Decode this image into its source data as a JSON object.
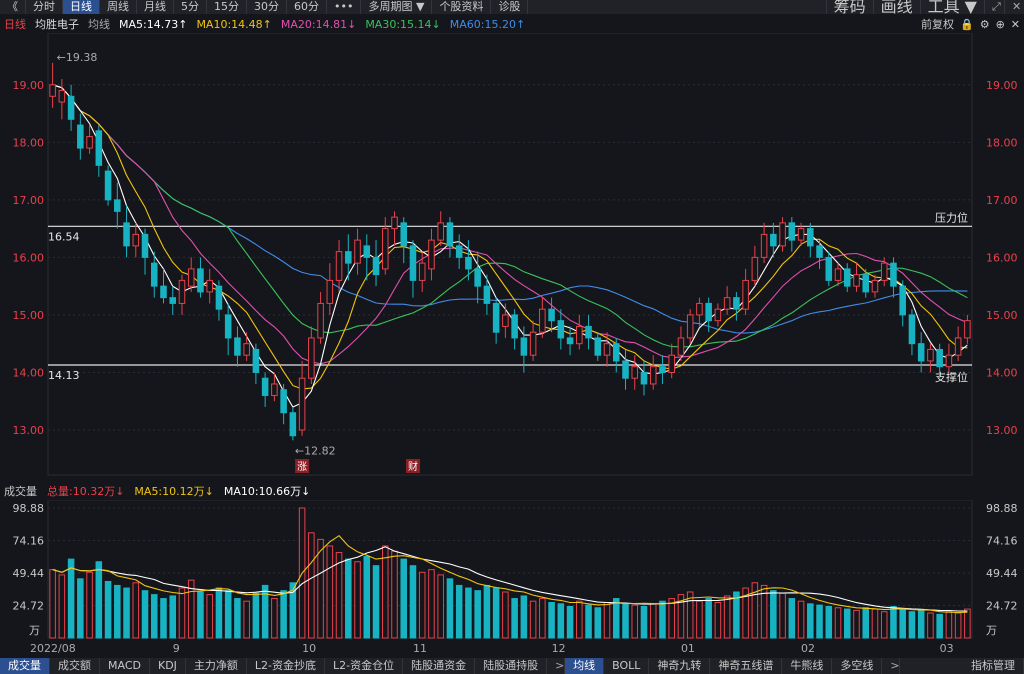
{
  "toolbar": {
    "back": "《",
    "items": [
      "分时",
      "日线",
      "周线",
      "月线",
      "5分",
      "15分",
      "30分",
      "60分",
      "•••",
      "多周期图 ▼",
      "个股资料",
      "诊股"
    ],
    "active_index": 1,
    "right": [
      "筹码",
      "画线",
      "工具 ▼"
    ],
    "icons": [
      "⤢",
      "✕"
    ]
  },
  "ma_bar": {
    "period": "日线",
    "stock": "均胜电子",
    "label": "均线",
    "ma5": "MA5:14.73↑",
    "ma10": "MA10:14.48↑",
    "ma20": "MA20:14.81↓",
    "ma30": "MA30:15.14↓",
    "ma60": "MA60:15.20↑",
    "adjust": "前复权"
  },
  "price_axis": {
    "labels": [
      "19.00",
      "18.00",
      "17.00",
      "16.00",
      "15.00",
      "14.00",
      "13.00"
    ],
    "values": [
      19,
      18,
      17,
      16,
      15,
      14,
      13
    ]
  },
  "annotations": {
    "high": "←19.38",
    "low": "←12.82",
    "resistance_value": "16.54",
    "resistance_label": "压力位",
    "support_value": "14.13",
    "support_label": "支撑位",
    "badge1": "涨",
    "badge2": "财"
  },
  "colors": {
    "up": "#e8414b",
    "down": "#18b3c2",
    "ma5": "#ffffff",
    "ma10": "#f1c40f",
    "ma20": "#e050b0",
    "ma30": "#3ac25a",
    "ma60": "#3f8ce8"
  },
  "volume": {
    "title": "成交量",
    "total": "总量:10.32万↓",
    "ma5": "MA5:10.12万↓",
    "ma10": "MA10:10.66万↓",
    "axis_labels": [
      "98.88",
      "74.16",
      "49.44",
      "24.72",
      "万"
    ],
    "axis_values": [
      98.88,
      74.16,
      49.44,
      24.72
    ]
  },
  "xaxis": [
    "2022/08",
    "9",
    "10",
    "11",
    "12",
    "01",
    "02",
    "03"
  ],
  "tabs": [
    "成交量",
    "成交额",
    "MACD",
    "KDJ",
    "主力净额",
    "L2-资金抄底",
    "L2-资金仓位",
    "陆股通资金",
    "陆股通持股",
    ">",
    "均线",
    "BOLL",
    "神奇九转",
    "神奇五线谱",
    "牛熊线",
    "多空线",
    ">",
    "指标管理"
  ],
  "active_tab": 0,
  "active_tab2": 10,
  "chart_data": {
    "type": "candlestick",
    "ylim": [
      12.6,
      19.9
    ],
    "candles": [
      [
        18.8,
        19.0,
        19.38,
        18.6
      ],
      [
        18.7,
        18.9,
        19.1,
        18.4
      ],
      [
        18.8,
        18.4,
        19.0,
        18.2
      ],
      [
        18.3,
        17.9,
        18.5,
        17.7
      ],
      [
        17.9,
        18.1,
        18.3,
        17.8
      ],
      [
        18.2,
        17.6,
        18.3,
        17.4
      ],
      [
        17.5,
        17.0,
        17.6,
        16.9
      ],
      [
        17.0,
        16.8,
        17.3,
        16.5
      ],
      [
        16.6,
        16.2,
        16.9,
        16.0
      ],
      [
        16.2,
        16.4,
        16.6,
        16.0
      ],
      [
        16.4,
        16.0,
        16.5,
        15.7
      ],
      [
        15.9,
        15.5,
        16.1,
        15.3
      ],
      [
        15.5,
        15.3,
        15.8,
        15.2
      ],
      [
        15.3,
        15.2,
        15.5,
        15.0
      ],
      [
        15.2,
        15.6,
        15.7,
        15.0
      ],
      [
        15.5,
        15.8,
        16.0,
        15.4
      ],
      [
        15.8,
        15.4,
        16.0,
        15.3
      ],
      [
        15.4,
        15.6,
        15.8,
        15.2
      ],
      [
        15.5,
        15.1,
        15.6,
        14.9
      ],
      [
        15.0,
        14.6,
        15.2,
        14.3
      ],
      [
        14.6,
        14.3,
        14.8,
        14.1
      ],
      [
        14.3,
        14.5,
        14.7,
        14.2
      ],
      [
        14.4,
        14.0,
        14.5,
        13.8
      ],
      [
        13.9,
        13.6,
        14.0,
        13.4
      ],
      [
        13.6,
        13.8,
        14.0,
        13.5
      ],
      [
        13.7,
        13.3,
        13.8,
        13.1
      ],
      [
        13.3,
        12.9,
        13.4,
        12.82
      ],
      [
        13.0,
        13.9,
        14.2,
        12.9
      ],
      [
        13.9,
        14.6,
        14.8,
        13.8
      ],
      [
        14.6,
        15.2,
        15.4,
        14.5
      ],
      [
        15.2,
        15.6,
        15.9,
        15.0
      ],
      [
        15.6,
        16.1,
        16.3,
        15.4
      ],
      [
        16.1,
        15.9,
        16.4,
        15.6
      ],
      [
        15.9,
        16.3,
        16.5,
        15.7
      ],
      [
        16.2,
        16.0,
        16.4,
        15.6
      ],
      [
        16.0,
        15.7,
        16.3,
        15.5
      ],
      [
        15.8,
        16.5,
        16.7,
        15.7
      ],
      [
        16.5,
        16.7,
        16.8,
        16.2
      ],
      [
        16.6,
        16.2,
        16.7,
        15.9
      ],
      [
        16.2,
        15.6,
        16.3,
        15.3
      ],
      [
        15.6,
        15.9,
        16.1,
        15.4
      ],
      [
        15.8,
        16.3,
        16.5,
        15.6
      ],
      [
        16.3,
        16.6,
        16.8,
        16.2
      ],
      [
        16.6,
        16.2,
        16.7,
        16.0
      ],
      [
        16.2,
        16.0,
        16.4,
        15.8
      ],
      [
        16.0,
        15.8,
        16.3,
        15.6
      ],
      [
        15.8,
        15.5,
        16.1,
        15.2
      ],
      [
        15.5,
        15.2,
        15.7,
        15.0
      ],
      [
        15.2,
        14.7,
        15.3,
        14.5
      ],
      [
        14.8,
        15.0,
        15.2,
        14.6
      ],
      [
        15.0,
        14.6,
        15.1,
        14.4
      ],
      [
        14.6,
        14.3,
        14.8,
        14.0
      ],
      [
        14.3,
        14.7,
        14.9,
        14.2
      ],
      [
        14.7,
        15.1,
        15.3,
        14.6
      ],
      [
        15.1,
        14.9,
        15.3,
        14.7
      ],
      [
        14.9,
        14.6,
        15.1,
        14.4
      ],
      [
        14.6,
        14.5,
        14.8,
        14.3
      ],
      [
        14.5,
        14.8,
        15.0,
        14.4
      ],
      [
        14.8,
        14.6,
        15.0,
        14.4
      ],
      [
        14.6,
        14.3,
        14.7,
        14.2
      ],
      [
        14.3,
        14.5,
        14.7,
        14.1
      ],
      [
        14.5,
        14.2,
        14.6,
        14.0
      ],
      [
        14.2,
        13.9,
        14.4,
        13.7
      ],
      [
        13.9,
        14.1,
        14.3,
        13.7
      ],
      [
        14.0,
        13.8,
        14.2,
        13.6
      ],
      [
        13.8,
        14.1,
        14.3,
        13.7
      ],
      [
        14.1,
        14.0,
        14.3,
        13.8
      ],
      [
        14.0,
        14.3,
        14.5,
        13.9
      ],
      [
        14.3,
        14.6,
        14.8,
        14.2
      ],
      [
        14.6,
        15.0,
        15.1,
        14.5
      ],
      [
        15.0,
        15.2,
        15.3,
        14.8
      ],
      [
        15.2,
        14.9,
        15.3,
        14.7
      ],
      [
        14.9,
        15.1,
        15.2,
        14.8
      ],
      [
        15.1,
        15.3,
        15.5,
        15.0
      ],
      [
        15.3,
        15.1,
        15.4,
        14.9
      ],
      [
        15.1,
        15.6,
        15.8,
        15.0
      ],
      [
        15.6,
        16.0,
        16.2,
        15.5
      ],
      [
        16.0,
        16.4,
        16.6,
        15.9
      ],
      [
        16.4,
        16.2,
        16.6,
        16.0
      ],
      [
        16.2,
        16.6,
        16.7,
        16.1
      ],
      [
        16.6,
        16.3,
        16.7,
        16.1
      ],
      [
        16.3,
        16.5,
        16.6,
        16.2
      ],
      [
        16.5,
        16.2,
        16.6,
        16.0
      ],
      [
        16.2,
        16.0,
        16.3,
        15.8
      ],
      [
        16.0,
        15.6,
        16.1,
        15.5
      ],
      [
        15.6,
        15.8,
        15.9,
        15.5
      ],
      [
        15.8,
        15.5,
        15.9,
        15.4
      ],
      [
        15.5,
        15.7,
        15.9,
        15.4
      ],
      [
        15.7,
        15.4,
        15.8,
        15.3
      ],
      [
        15.4,
        15.6,
        15.7,
        15.3
      ],
      [
        15.6,
        15.9,
        16.0,
        15.5
      ],
      [
        15.9,
        15.5,
        16.0,
        15.3
      ],
      [
        15.5,
        15.0,
        15.6,
        14.8
      ],
      [
        15.0,
        14.5,
        15.1,
        14.3
      ],
      [
        14.5,
        14.2,
        14.7,
        14.0
      ],
      [
        14.2,
        14.4,
        14.5,
        14.0
      ],
      [
        14.4,
        14.1,
        14.5,
        13.9
      ],
      [
        14.1,
        14.3,
        14.5,
        14.0
      ],
      [
        14.3,
        14.6,
        14.8,
        14.2
      ],
      [
        14.6,
        14.9,
        15.0,
        14.5
      ]
    ],
    "volumes": [
      52,
      48,
      60,
      45,
      50,
      58,
      43,
      40,
      38,
      42,
      36,
      33,
      30,
      32,
      38,
      44,
      35,
      33,
      38,
      36,
      30,
      28,
      34,
      40,
      30,
      36,
      42,
      98.88,
      80,
      75,
      70,
      65,
      60,
      58,
      62,
      55,
      70,
      66,
      60,
      55,
      50,
      52,
      48,
      45,
      40,
      38,
      36,
      40,
      38,
      35,
      30,
      32,
      28,
      30,
      27,
      26,
      24,
      28,
      25,
      23,
      27,
      30,
      26,
      25,
      24,
      26,
      28,
      30,
      33,
      35,
      28,
      30,
      27,
      32,
      35,
      38,
      42,
      40,
      36,
      34,
      30,
      28,
      26,
      25,
      24,
      23,
      22,
      21,
      23,
      22,
      20,
      24,
      22,
      20,
      21,
      19,
      18,
      20,
      19,
      22
    ]
  }
}
